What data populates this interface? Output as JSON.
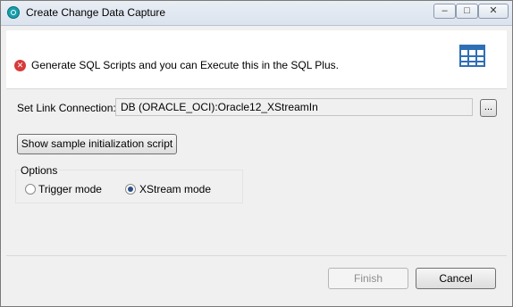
{
  "window": {
    "title": "Create Change Data Capture"
  },
  "titlebar_buttons": {
    "minimize": "–",
    "maximize": "□",
    "close": "✕"
  },
  "header": {
    "message": "Generate SQL Scripts and you can Execute this in the SQL Plus."
  },
  "link_connection": {
    "label": "Set Link Connection:",
    "value": "DB (ORACLE_OCI):Oracle12_XStreamIn",
    "browse_label": "..."
  },
  "show_script_button": "Show sample initialization script",
  "options": {
    "title": "Options",
    "modes": [
      {
        "label": "Trigger mode",
        "selected": false
      },
      {
        "label": "XStream mode",
        "selected": true
      }
    ]
  },
  "footer": {
    "finish_label": "Finish",
    "cancel_label": "Cancel"
  },
  "colors": {
    "error": "#d83a3a",
    "accent": "#2f6fb5",
    "app_icon": "#16a0ab"
  },
  "icons": [
    "app-icon",
    "error-icon",
    "table-icon"
  ]
}
